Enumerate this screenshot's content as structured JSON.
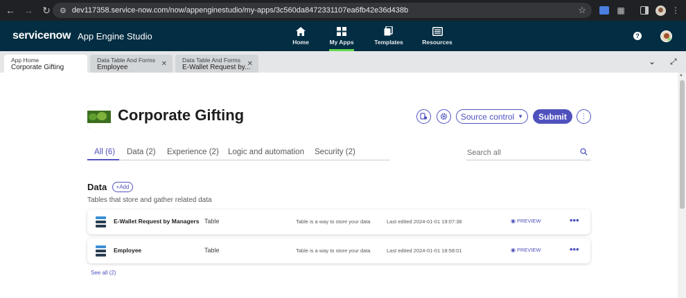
{
  "browser": {
    "url": "dev117358.service-now.com/now/appenginestudio/my-apps/3c560da8472331107ea6fb42e36d438b"
  },
  "header": {
    "brand": "servicenow",
    "app_name": "App Engine Studio",
    "nav": [
      {
        "label": "Home",
        "icon": "home-icon"
      },
      {
        "label": "My Apps",
        "icon": "grid-icon",
        "active": true
      },
      {
        "label": "Templates",
        "icon": "templates-icon"
      },
      {
        "label": "Resources",
        "icon": "resources-icon"
      }
    ],
    "help": "?"
  },
  "tabs": [
    {
      "title": "App Home",
      "subtitle": "Corporate Gifting",
      "active": true,
      "closable": false
    },
    {
      "title": "Data Table And Forms",
      "subtitle": "Employee",
      "closable": true
    },
    {
      "title": "Data Table And Forms",
      "subtitle": "E-Wallet Request by...",
      "closable": true
    }
  ],
  "app": {
    "title": "Corporate Gifting",
    "source_control_label": "Source control",
    "submit_label": "Submit"
  },
  "content_tabs": [
    {
      "label": "All (6)",
      "active": true
    },
    {
      "label": "Data (2)"
    },
    {
      "label": "Experience (2)"
    },
    {
      "label": "Logic and automation"
    },
    {
      "label": "Security (2)"
    }
  ],
  "search": {
    "placeholder": "Search all"
  },
  "data_section": {
    "title": "Data",
    "add_label": "+Add",
    "description": "Tables that store and gather related data",
    "rows": [
      {
        "name": "E-Wallet Request by Managers",
        "type": "Table",
        "description": "Table is a way to store your data",
        "edited": "Last edited 2024-01-01 19:07:38",
        "preview": "PREVIEW"
      },
      {
        "name": "Employee",
        "type": "Table",
        "description": "Table is a way to store your data",
        "edited": "Last edited 2024-01-01 18:58:01",
        "preview": "PREVIEW"
      }
    ],
    "see_all": "See all (2)"
  },
  "colors": {
    "header_bg": "#032d42",
    "accent": "#4f52bd",
    "nav_active": "#62d84e"
  }
}
